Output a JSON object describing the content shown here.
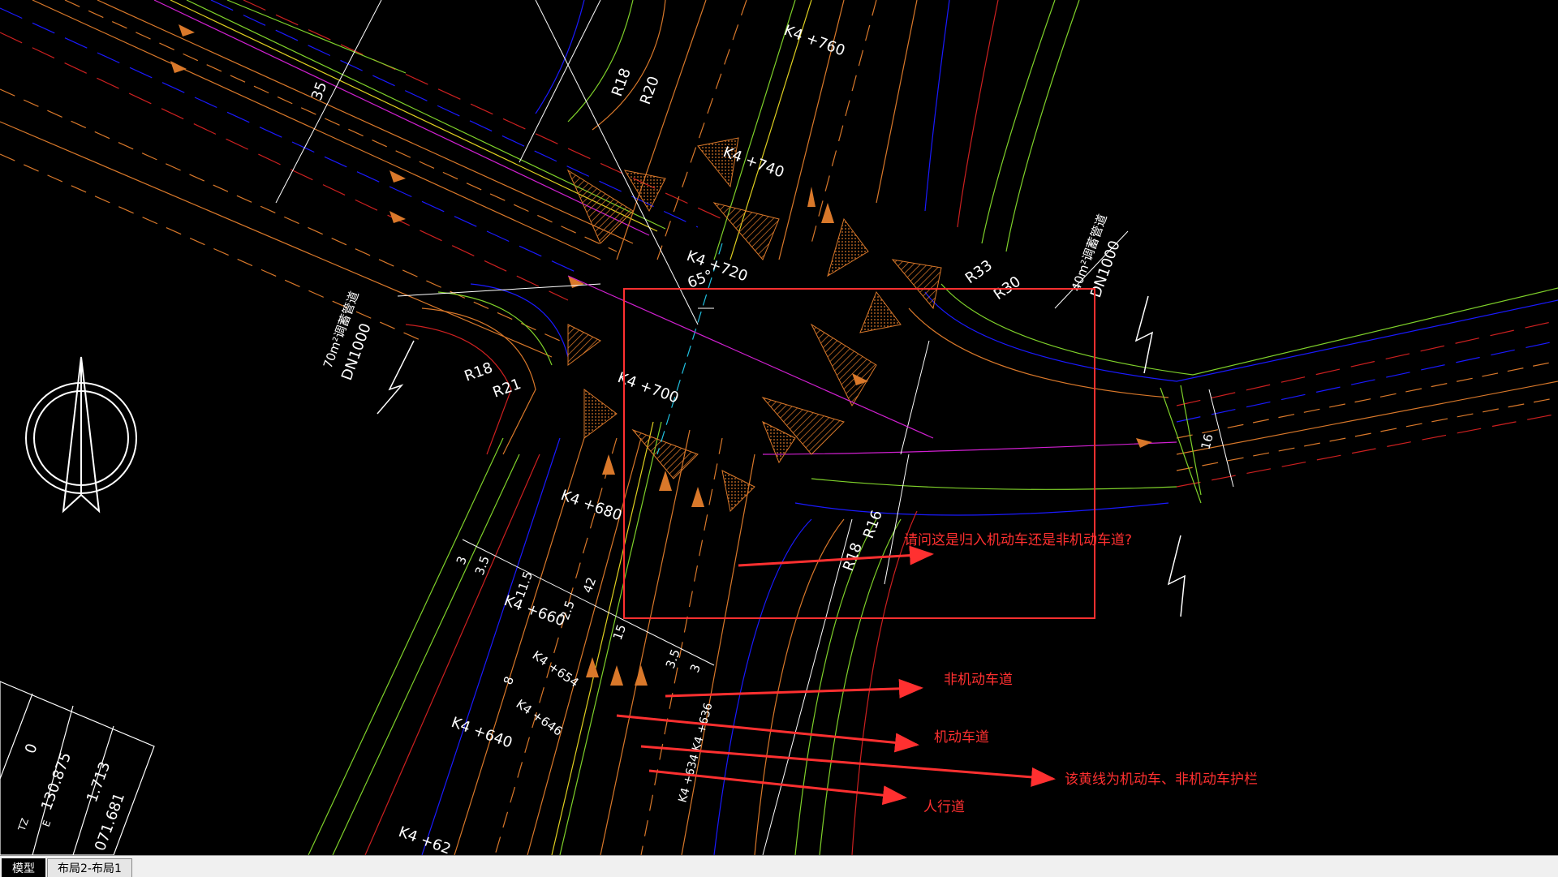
{
  "tabs": [
    {
      "label": "模型"
    },
    {
      "label": "布局2-布局1"
    }
  ],
  "annotations": {
    "question": "请问这是归入机动车还是非机动车道?",
    "non_motor_lane": "非机动车道",
    "motor_lane": "机动车道",
    "guardrail": "该黄线为机动车、非机动车护栏",
    "sidewalk": "人行道"
  },
  "drawing_labels": {
    "k4_760": "K4 +760",
    "k4_740": "K4 +740",
    "k4_720": "K4 +720",
    "k4_700": "K4 +700",
    "k4_680": "K4 +680",
    "k4_660": "K4 +660",
    "k4_654": "K4 +654",
    "k4_646": "K4 +646",
    "k4_640": "K4 +640",
    "k4_620": "K4 +62",
    "k4_634": "K4 +634 K4 +636",
    "r18_top": "R18",
    "r20_top": "R20",
    "r18_left": "R18",
    "r21_left": "R21",
    "r33": "R33",
    "r30": "R30",
    "r18_br": "R18",
    "r16_br": "R16",
    "angle": "65°",
    "pipe_left_1": "70m²调蓄管道",
    "pipe_left_2": "DN1000",
    "pipe_right_1": "40m²调蓄管道",
    "pipe_right_2": "DN1000",
    "dim_35_top": "35",
    "dim_16": "16",
    "dim_3": "3",
    "dim_35a": "3.5",
    "dim_115": "11.5",
    "dim_42": "42",
    "dim_25": "2.5",
    "dim_15": "15",
    "dim_8": "8",
    "dim_35b": "3.5",
    "dim_3b": "3",
    "table_v1": "0",
    "table_v2": "130.875",
    "table_v3": "1.713",
    "table_v4": "071.681",
    "table_l1": "TZ",
    "table_l2": "E"
  },
  "colors": {
    "background": "#000000",
    "annotation_red": "#ff3030",
    "road_orange": "#d9782a",
    "road_green": "#7fd12a",
    "road_yellow": "#e0d020",
    "road_blue": "#1a1aff",
    "road_red": "#cc2020",
    "road_magenta": "#d020d0",
    "road_cyan": "#20c0e0"
  }
}
